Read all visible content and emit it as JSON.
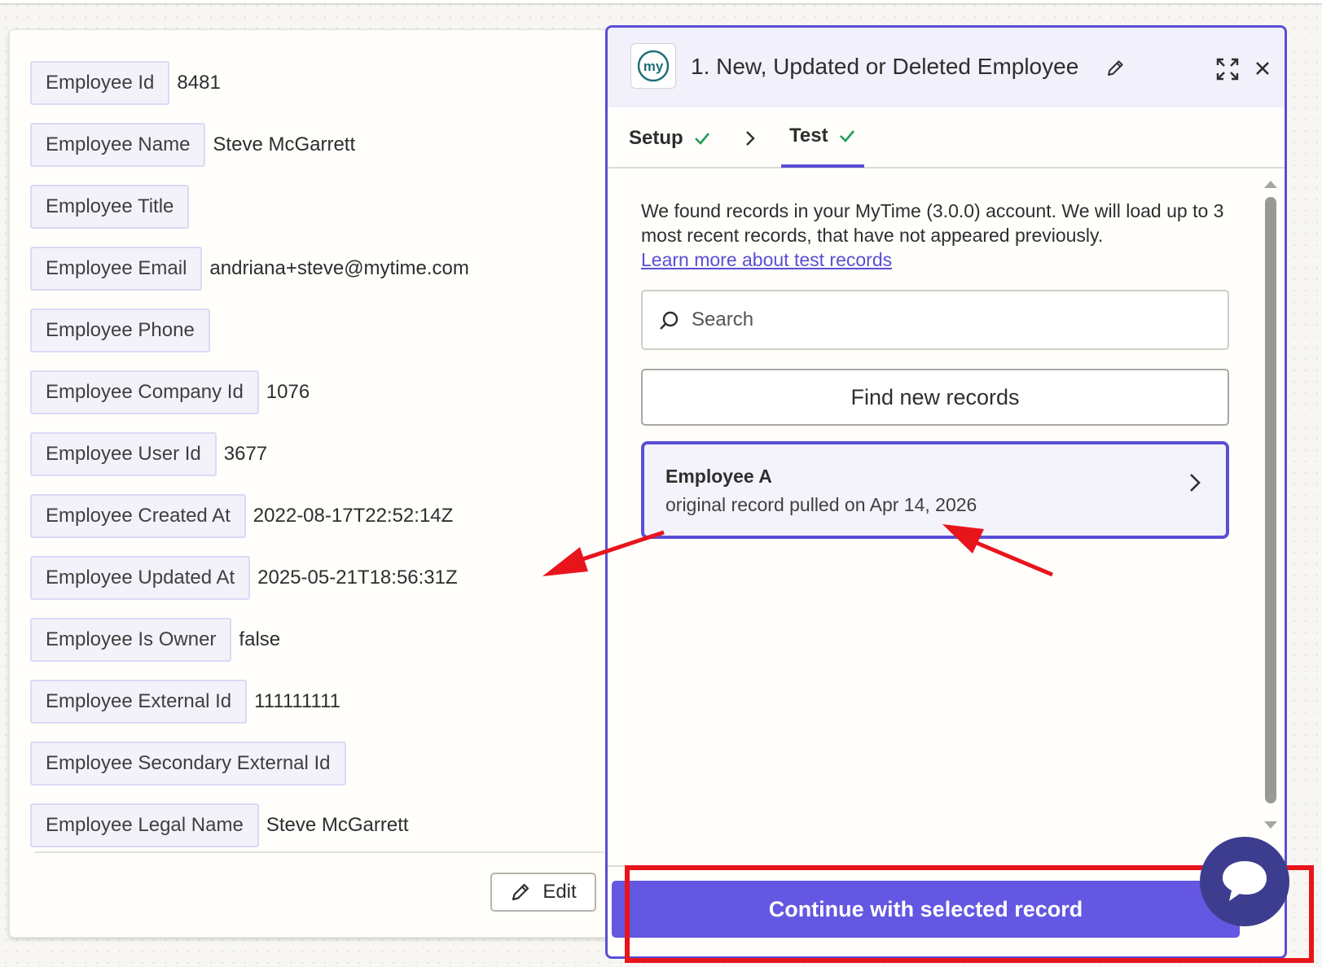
{
  "details": {
    "fields": [
      {
        "key": "Employee Id",
        "value": "8481"
      },
      {
        "key": "Employee Name",
        "value": "Steve McGarrett"
      },
      {
        "key": "Employee Title",
        "value": ""
      },
      {
        "key": "Employee Email",
        "value": "andriana+steve@mytime.com"
      },
      {
        "key": "Employee Phone",
        "value": ""
      },
      {
        "key": "Employee Company Id",
        "value": "1076"
      },
      {
        "key": "Employee User Id",
        "value": "3677"
      },
      {
        "key": "Employee Created At",
        "value": "2022-08-17T22:52:14Z"
      },
      {
        "key": "Employee Updated At",
        "value": "2025-05-21T18:56:31Z"
      },
      {
        "key": "Employee Is Owner",
        "value": "false"
      },
      {
        "key": "Employee External Id",
        "value": "111111111"
      },
      {
        "key": "Employee Secondary External Id",
        "value": ""
      },
      {
        "key": "Employee Legal Name",
        "value": "Steve McGarrett"
      }
    ],
    "edit_label": "Edit"
  },
  "panel": {
    "logo_text": "my",
    "title": "1. New, Updated or Deleted Employee",
    "tabs": [
      {
        "label": "Setup",
        "status": "complete"
      },
      {
        "label": "Test",
        "status": "complete",
        "active": true
      }
    ],
    "intro": "We found records in your MyTime (3.0.0) account. We will load up to 3 most recent records, that have not appeared previously.",
    "learn_more": "Learn more about test records",
    "search": {
      "placeholder": "Search",
      "value": ""
    },
    "find_label": "Find new records",
    "record": {
      "name": "Employee A",
      "subtitle": "original record pulled on Apr 14, 2026"
    },
    "continue_label": "Continue with selected record"
  },
  "colors": {
    "accent": "#5a4ed6",
    "button": "#6457e1",
    "success": "#1f9d55",
    "highlight": "#e8141c",
    "chat": "#3d3d8f"
  },
  "icons": {
    "title_edit": "pencil-icon",
    "expand": "expand-icon",
    "close": "close-icon",
    "tab_check": "check-icon",
    "tab_separator": "chevron-right-icon",
    "search": "search-icon",
    "record_open": "chevron-right-icon",
    "edit": "pencil-icon",
    "chat": "chat-bubble-icon"
  }
}
